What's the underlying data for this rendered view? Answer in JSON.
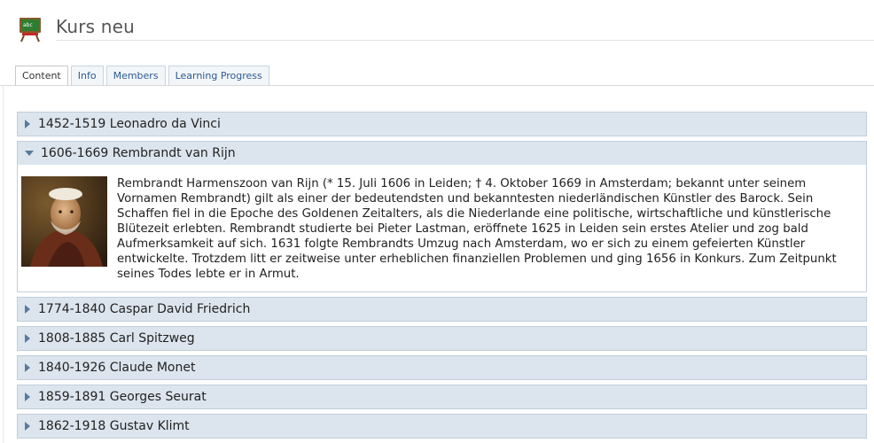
{
  "header": {
    "title": "Kurs neu",
    "icon": "chalkboard-icon"
  },
  "tabs": [
    {
      "label": "Content",
      "active": true
    },
    {
      "label": "Info",
      "active": false
    },
    {
      "label": "Members",
      "active": false
    },
    {
      "label": "Learning Progress",
      "active": false
    }
  ],
  "accordion": {
    "items": [
      {
        "title": "1452-1519 Leonadro da Vinci",
        "expanded": false
      },
      {
        "title": "1606-1669 Rembrandt van Rijn",
        "expanded": true,
        "body": "Rembrandt Harmenszoon van Rijn (* 15. Juli 1606 in Leiden; † 4. Oktober 1669 in Amsterdam; bekannt unter seinem Vornamen Rembrandt) gilt als einer der bedeutendsten und bekanntesten niederländischen Künstler des Barock. Sein Schaffen fiel in die Epoche des Goldenen Zeitalters, als die Niederlande eine politische, wirtschaftliche und künstlerische Blütezeit erlebten. Rembrandt studierte bei Pieter Lastman, eröffnete 1625 in Leiden sein erstes Atelier und zog bald Aufmerksamkeit auf sich. 1631 folgte Rembrandts Umzug nach Amsterdam, wo er sich zu einem gefeierten Künstler entwickelte. Trotzdem litt er zeitweise unter erheblichen finanziellen Problemen und ging 1656 in Konkurs. Zum Zeitpunkt seines Todes lebte er in Armut."
      },
      {
        "title": "1774-1840 Caspar David Friedrich",
        "expanded": false
      },
      {
        "title": "1808-1885 Carl Spitzweg",
        "expanded": false
      },
      {
        "title": "1840-1926 Claude Monet",
        "expanded": false
      },
      {
        "title": "1859-1891 Georges Seurat",
        "expanded": false
      },
      {
        "title": "1862-1918 Gustav Klimt",
        "expanded": false
      }
    ]
  },
  "colors": {
    "header_bg": "#dce5ee",
    "border": "#c0cedb",
    "link": "#2b5b93",
    "arrow": "#5a7a9c"
  }
}
